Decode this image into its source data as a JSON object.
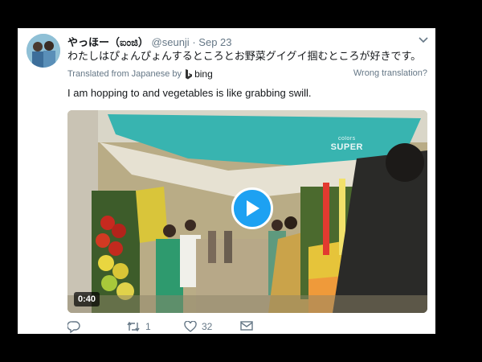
{
  "tweet": {
    "display_name": "やっほー（ಐಂಜಿ）",
    "handle": "@seunji",
    "separator": "·",
    "date": "Sep 23",
    "original_text": "わたしはぴょんぴょんするところとお野菜グイグイ掴むところが好きです。",
    "translated_from": "Translated from Japanese by",
    "translator": "bing",
    "wrong_translation": "Wrong translation?",
    "translated_text": "I am hopping to and vegetables is like grabbing swill."
  },
  "video": {
    "duration": "0:40",
    "watermark_top": "colors",
    "watermark_main": "SUPER"
  },
  "actions": {
    "reply_count": "",
    "retweet_count": "1",
    "like_count": "32"
  },
  "icons": [
    "chevron-down-icon",
    "bing-logo-icon",
    "play-icon",
    "reply-icon",
    "retweet-icon",
    "like-icon",
    "message-icon"
  ],
  "colors": {
    "accent": "#1da1f2",
    "text": "#14171a",
    "muted": "#657786"
  }
}
